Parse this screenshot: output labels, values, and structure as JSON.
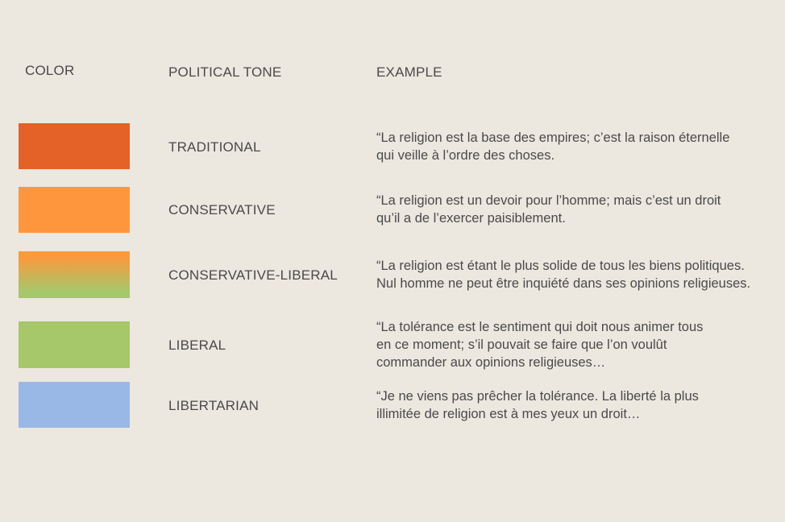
{
  "headers": {
    "color": "COLOR",
    "tone": "POLITICAL TONE",
    "example": "EXAMPLE"
  },
  "rows": [
    {
      "tone": "TRADITIONAL",
      "color": "#e46128",
      "example": [
        "“La religion est la base des empires; c’est la raison éternelle",
        "qui veille à l’ordre des choses."
      ]
    },
    {
      "tone": "CONSERVATIVE",
      "color": "#fe963d",
      "example": [
        "“La religion est un devoir pour l’homme; mais c’est un droit",
        "qu’il a de l’exercer paisiblement."
      ]
    },
    {
      "tone": "CONSERVATIVE-LIBERAL",
      "color_gradient": [
        "#f99a3e",
        "#a6c76a"
      ],
      "example": [
        "“La religion est étant le plus solide de tous les biens politiques.",
        "Nul homme ne peut être inquiété dans ses opinions religieuses."
      ]
    },
    {
      "tone": "LIBERAL",
      "color": "#a6c76a",
      "example": [
        "“La tolérance est le sentiment qui doit nous animer tous",
        "en ce moment; s’il pouvait se faire que l’on voulût",
        "commander aux opinions religieuses…"
      ]
    },
    {
      "tone": "LIBERTARIAN",
      "color": "#9ab8e6",
      "example": [
        "“Je ne viens pas prêcher la tolérance. La liberté la plus",
        "illimitée de religion est à mes yeux un droit…"
      ]
    }
  ]
}
